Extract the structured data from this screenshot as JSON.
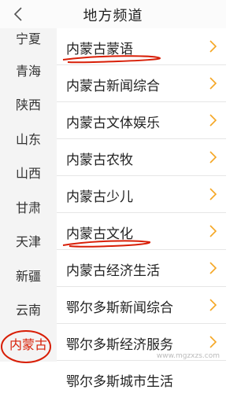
{
  "header": {
    "title": "地方频道"
  },
  "sidebar": {
    "items": [
      "宁夏",
      "青海",
      "陕西",
      "山东",
      "山西",
      "甘肃",
      "天津",
      "新疆",
      "云南",
      "内蒙古"
    ],
    "active_index": 9
  },
  "list": {
    "items": [
      "内蒙古蒙语",
      "内蒙古新闻综合",
      "内蒙古文体娱乐",
      "内蒙古农牧",
      "内蒙古少儿",
      "内蒙古文化",
      "内蒙古经济生活",
      "鄂尔多斯新闻综合",
      "鄂尔多斯经济服务",
      "鄂尔多斯城市生活"
    ]
  },
  "watermark": "www.mgzxzs.com",
  "colors": {
    "accent": "#d81e06",
    "chevron": "#f5a623"
  },
  "icons": {
    "back": "chevron-left-icon",
    "row": "chevron-right-icon"
  }
}
